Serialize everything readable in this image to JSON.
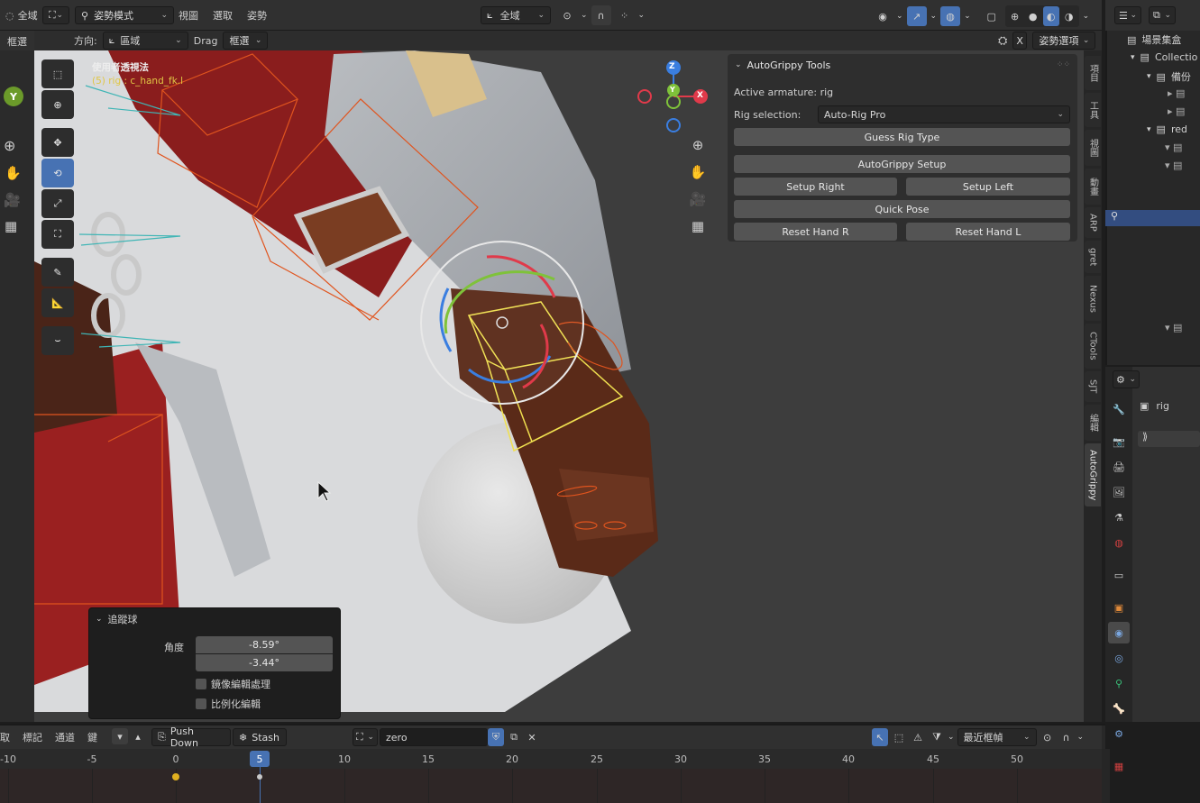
{
  "top_header": {
    "global_label": "全域",
    "mode_label": "姿勢模式",
    "menu": [
      "視圖",
      "選取",
      "姿勢"
    ],
    "transform_orientation": "全域"
  },
  "tool_header": {
    "left_label": "框選",
    "direction_label": "方向:",
    "direction_value": "區域",
    "drag_label": "Drag",
    "drag_value": "框選",
    "x_label": "X",
    "pose_options": "姿勢選項"
  },
  "viewport": {
    "view_name": "使用者透視法",
    "active_object": "(5) rig : c_hand_fk.l",
    "gizmo": {
      "z": "Z",
      "x": "X",
      "y": "Y"
    }
  },
  "autogrippy": {
    "title": "AutoGrippy Tools",
    "active_armature": "Active armature: rig",
    "rig_selection_label": "Rig selection:",
    "rig_selection_value": "Auto-Rig Pro",
    "buttons": {
      "guess": "Guess Rig Type",
      "setup": "AutoGrippy Setup",
      "setup_right": "Setup Right",
      "setup_left": "Setup Left",
      "quick_pose": "Quick Pose",
      "reset_r": "Reset Hand R",
      "reset_l": "Reset Hand L"
    }
  },
  "sidebar_tabs": [
    "項目",
    "工具",
    "視圖",
    "動畫",
    "ARP",
    "gret",
    "Nexus",
    "CTools",
    "SJT",
    "編輯",
    "AutoGrippy"
  ],
  "operator_panel": {
    "title": "追蹤球",
    "angle_label": "角度",
    "angle_1": "-8.59°",
    "angle_2": "-3.44°",
    "mirror_label": "鏡像編輯處理",
    "proportional_label": "比例化編輯"
  },
  "outliner": {
    "scene_collection": "場景集盒",
    "items": [
      "Collectio",
      "備份",
      "red"
    ]
  },
  "properties": {
    "object_name": "rig"
  },
  "timeline": {
    "menu": [
      "取",
      "標記",
      "通道",
      "鍵"
    ],
    "push_down": "Push Down",
    "stash": "Stash",
    "action_name": "zero",
    "interp": "最近框幀",
    "current_frame": "5",
    "ticks": [
      "-10",
      "-5",
      "0",
      "5",
      "10",
      "15",
      "20",
      "25",
      "30",
      "35",
      "40",
      "45",
      "50"
    ]
  },
  "colors": {
    "accent": "#4772b3",
    "panel": "#303030",
    "viewport_bg": "#3d3d3d",
    "button": "#545454",
    "warning_text": "#e0c645"
  }
}
